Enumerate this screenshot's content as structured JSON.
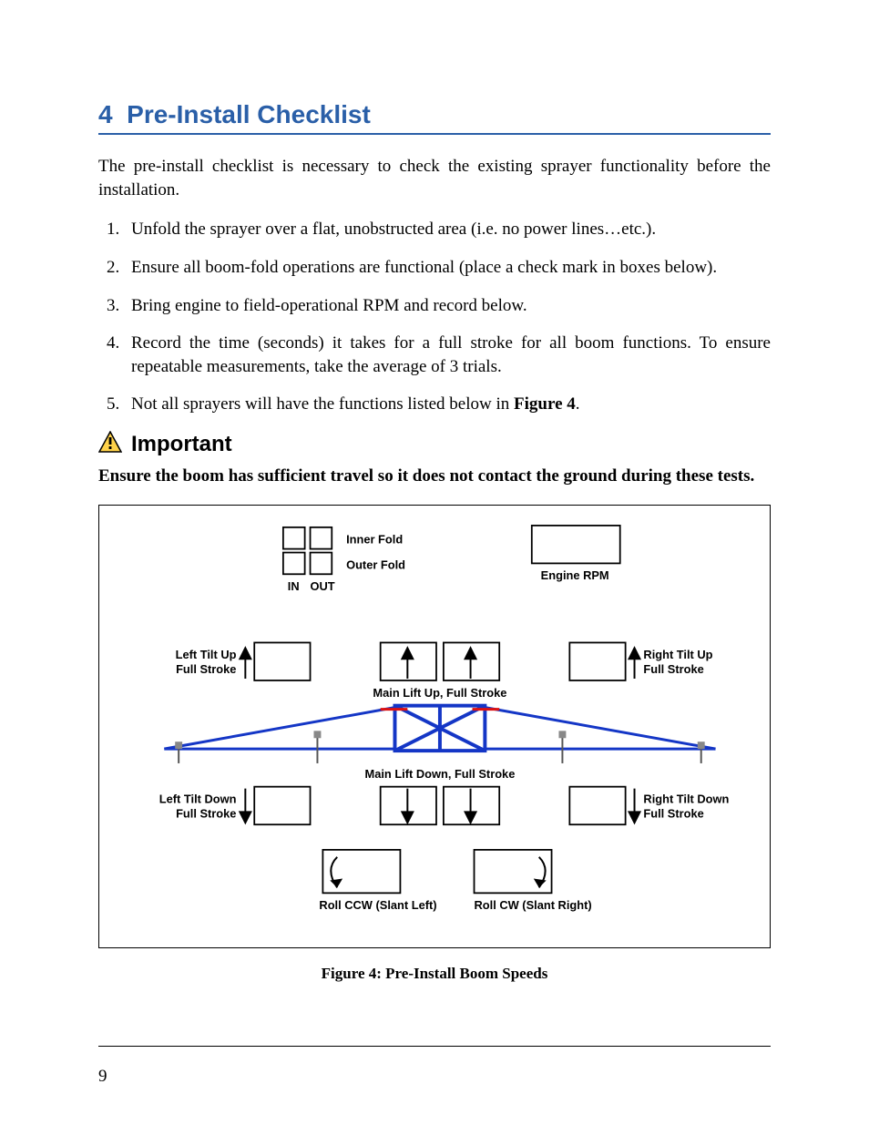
{
  "section": {
    "number": "4",
    "title": "Pre-Install Checklist"
  },
  "intro": "The pre-install checklist is necessary to check the existing sprayer functionality before the installation.",
  "steps": [
    "Unfold the sprayer over a flat, unobstructed area (i.e. no power lines…etc.).",
    "Ensure all boom-fold operations are functional (place a check mark in boxes below).",
    "Bring engine to field-operational RPM and record below.",
    "Record the time (seconds) it takes for a full stroke for all boom functions.  To ensure repeatable measurements, take the average of 3 trials.",
    "Not all sprayers will have the functions listed below in "
  ],
  "fig_ref": "Figure 4",
  "step5_tail": ".",
  "important_label": "Important",
  "warning_text": "Ensure the boom has sufficient travel so it does not contact the ground during these tests.",
  "figure": {
    "labels": {
      "inner_fold": "Inner Fold",
      "outer_fold": "Outer Fold",
      "in": "IN",
      "out": "OUT",
      "engine_rpm": "Engine RPM",
      "left_tilt_up": "Left Tilt Up",
      "left_full_stroke": "Full Stroke",
      "right_tilt_up": "Right Tilt Up",
      "right_full_stroke": "Full Stroke",
      "main_lift_up": "Main Lift Up, Full Stroke",
      "main_lift_down": "Main Lift Down, Full Stroke",
      "left_tilt_down": "Left Tilt Down",
      "right_tilt_down": "Right Tilt  Down",
      "roll_ccw": "Roll CCW (Slant Left)",
      "roll_cw": "Roll CW (Slant Right)"
    }
  },
  "caption": "Figure 4: Pre-Install Boom Speeds",
  "page_number": "9"
}
